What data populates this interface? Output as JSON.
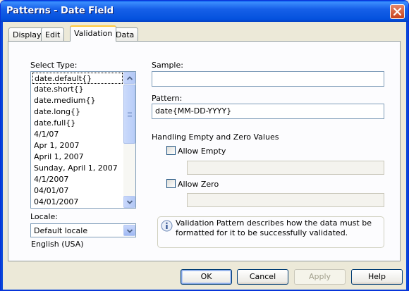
{
  "window": {
    "title": "Patterns - Date Field"
  },
  "tabs": [
    {
      "label": "Display"
    },
    {
      "label": "Edit"
    },
    {
      "label": "Validation"
    },
    {
      "label": "Data"
    }
  ],
  "select_type": {
    "label": "Select Type:",
    "items": [
      "date.default{}",
      "date.short{}",
      "date.medium{}",
      "date.long{}",
      "date.full{}",
      "4/1/07",
      "Apr 1, 2007",
      "April 1, 2007",
      "Sunday, April 1, 2007",
      "4/1/2007",
      "04/01/07",
      "04/01/2007"
    ],
    "selected_index": 0
  },
  "locale": {
    "label": "Locale:",
    "selected": "Default locale",
    "description": "English (USA)"
  },
  "sample": {
    "label": "Sample:",
    "value": ""
  },
  "pattern": {
    "label": "Pattern:",
    "value": "date{MM-DD-YYYY}"
  },
  "handling": {
    "heading": "Handling Empty and Zero Values",
    "allow_empty": {
      "label": "Allow Empty",
      "checked": false,
      "value": ""
    },
    "allow_zero": {
      "label": "Allow Zero",
      "checked": false,
      "value": ""
    }
  },
  "info": {
    "icon": "info-icon",
    "text": "Validation Pattern describes how the data must be formatted for it to be successfully validated."
  },
  "buttons": {
    "ok": "OK",
    "cancel": "Cancel",
    "apply": "Apply",
    "help": "Help"
  },
  "colors": {
    "titlebar": "#0451dd",
    "dialog_bg": "#ece9d8",
    "tab_highlight": "#ffc83c",
    "input_border": "#7f9db9"
  }
}
